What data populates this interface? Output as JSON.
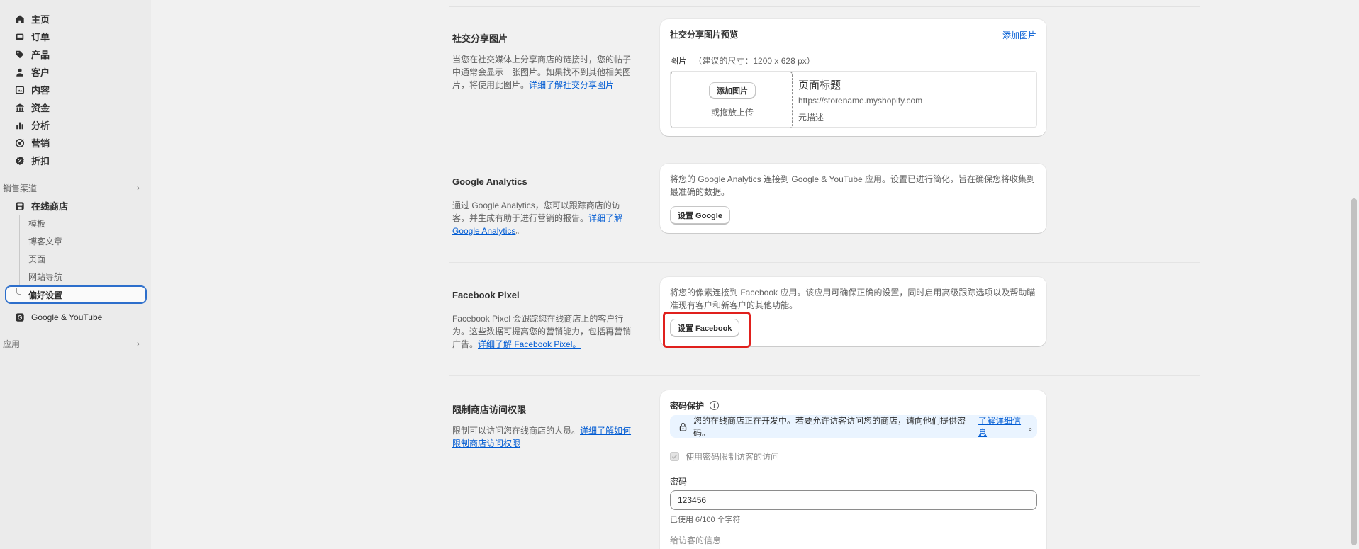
{
  "sidebar": {
    "nav": [
      {
        "label": "主页",
        "icon": "home-icon"
      },
      {
        "label": "订单",
        "icon": "inbox-icon"
      },
      {
        "label": "产品",
        "icon": "tag-icon"
      },
      {
        "label": "客户",
        "icon": "person-icon"
      },
      {
        "label": "内容",
        "icon": "content-icon"
      },
      {
        "label": "资金",
        "icon": "bank-icon"
      },
      {
        "label": "分析",
        "icon": "chart-bar-icon"
      },
      {
        "label": "营销",
        "icon": "target-icon"
      },
      {
        "label": "折扣",
        "icon": "discount-icon"
      }
    ],
    "sales_channels_label": "销售渠道",
    "online_store_label": "在线商店",
    "sub_items": [
      "模板",
      "博客文章",
      "页面",
      "网站导航"
    ],
    "active_item_label": "偏好设置",
    "google_youtube_label": "Google & YouTube",
    "apps_label": "应用"
  },
  "social": {
    "title": "社交分享图片",
    "desc": "当您在社交媒体上分享商店的链接时，您的帖子中通常会显示一张图片。如果找不到其他相关图片，将使用此图片。",
    "desc_link": "详细了解社交分享图片",
    "card_title": "社交分享图片预览",
    "add_image_link": "添加图片",
    "image_label": "图片",
    "image_hint": "（建议的尺寸：1200 x 628 px）",
    "add_image_button": "添加图片",
    "drop_text": "或拖放上传",
    "preview_title": "页面标题",
    "preview_url": "https://storename.myshopify.com",
    "preview_desc": "元描述"
  },
  "google": {
    "title": "Google Analytics",
    "desc": "通过 Google Analytics，您可以跟踪商店的访客，并生成有助于进行营销的报告。",
    "desc_link": "详细了解 Google Analytics",
    "desc_end": "。",
    "card_text": "将您的 Google Analytics 连接到 Google & YouTube 应用。设置已进行简化，旨在确保您将收集到最准确的数据。",
    "button": "设置 Google"
  },
  "facebook": {
    "title": "Facebook Pixel",
    "desc": "Facebook Pixel 会跟踪您在线商店上的客户行为。这些数据可提高您的营销能力，包括再营销广告。",
    "desc_link": "详细了解 Facebook Pixel。",
    "card_text": "将您的像素连接到 Facebook 应用。该应用可确保正确的设置，同时启用高级跟踪选项以及帮助瞄准现有客户和新客户的其他功能。",
    "button": "设置 Facebook"
  },
  "access": {
    "title": "限制商店访问权限",
    "desc": "限制可以访问您在线商店的人员。",
    "desc_link": "详细了解如何限制商店访问权限",
    "card_title": "密码保护",
    "banner_text": "您的在线商店正在开发中。若要允许访客访问您的商店，请向他们提供密码。",
    "banner_link": "了解详细信息",
    "banner_end": "。",
    "checkbox_label": "使用密码限制访客的访问",
    "checkbox_checked": true,
    "password_label": "密码",
    "password_value": "123456",
    "char_count": "已使用 6/100 个字符",
    "message_label": "给访客的信息"
  },
  "colors": {
    "accent": "#005bd3",
    "highlight": "#e0201d",
    "banner_bg": "#eaf4ff"
  }
}
